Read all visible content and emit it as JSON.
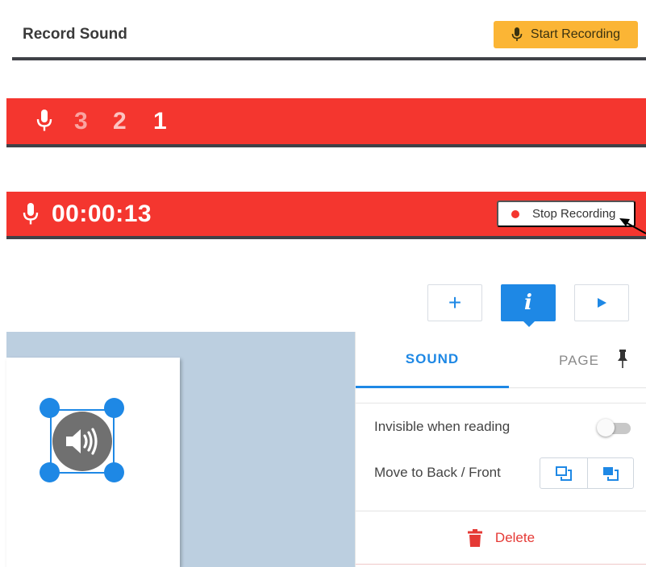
{
  "header": {
    "title": "Record Sound",
    "start_label": "Start Recording"
  },
  "countdown": {
    "numbers": [
      "3",
      "2",
      "1"
    ]
  },
  "recording": {
    "timer": "00:00:13",
    "stop_label": "Stop Recording"
  },
  "toolbar": {
    "info_glyph": "i",
    "add_glyph": "+"
  },
  "panel": {
    "tab_sound": "SOUND",
    "tab_page": "PAGE",
    "invisible_label": "Invisible when reading",
    "invisible_on": false,
    "move_label": "Move to Back / Front",
    "delete_label": "Delete"
  },
  "colors": {
    "accent": "#1e88e5",
    "record_red": "#f4362f",
    "start_yellow": "#fbb535",
    "delete_red": "#e53935"
  },
  "icons": {
    "mic": "microphone-icon",
    "play": "play-icon",
    "pin": "pin-icon",
    "trash": "trash-icon",
    "speaker": "speaker-icon",
    "send_back": "send-to-back-icon",
    "bring_front": "bring-to-front-icon"
  }
}
